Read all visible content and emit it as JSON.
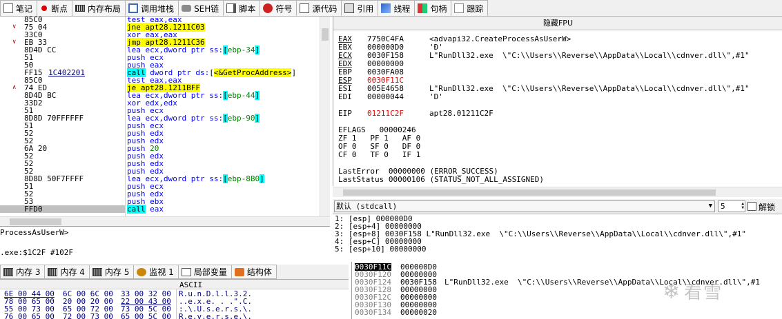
{
  "toolbar": {
    "tabs": [
      {
        "label": "笔记",
        "icon": "notes-icon"
      },
      {
        "label": "断点",
        "icon": "breakpoint-icon"
      },
      {
        "label": "内存布局",
        "icon": "memory-map-icon"
      },
      {
        "label": "调用堆栈",
        "icon": "call-stack-icon"
      },
      {
        "label": "SEH链",
        "icon": "seh-chain-icon"
      },
      {
        "label": "脚本",
        "icon": "script-icon"
      },
      {
        "label": "符号",
        "icon": "symbols-icon"
      },
      {
        "label": "源代码",
        "icon": "source-code-icon"
      },
      {
        "label": "引用",
        "icon": "references-icon"
      },
      {
        "label": "线程",
        "icon": "threads-icon"
      },
      {
        "label": "句柄",
        "icon": "handles-icon"
      },
      {
        "label": "跟踪",
        "icon": "trace-icon"
      }
    ]
  },
  "disasm": {
    "lines": [
      {
        "bytes": "85C0",
        "mark": "",
        "parts": [
          {
            "t": "test eax,eax",
            "c": "blue"
          }
        ]
      },
      {
        "bytes": "75 04",
        "mark": "v",
        "parts": [
          {
            "t": "jne apt28.1211C03",
            "c": "hl-y"
          }
        ]
      },
      {
        "bytes": "33C0",
        "mark": "",
        "parts": [
          {
            "t": "xor eax,eax",
            "c": "blue"
          }
        ]
      },
      {
        "bytes": "EB 33",
        "mark": "v",
        "parts": [
          {
            "t": "jmp apt28.1211C36",
            "c": "hl-y"
          }
        ]
      },
      {
        "bytes": "8D4D CC",
        "mark": "",
        "parts": [
          {
            "t": "lea ecx,dword ptr ss:",
            "c": "blue"
          },
          {
            "t": "[",
            "c": "hl-c"
          },
          {
            "t": "ebp-34",
            "c": "green"
          },
          {
            "t": "]",
            "c": "hl-c"
          }
        ]
      },
      {
        "bytes": "51",
        "mark": "",
        "parts": [
          {
            "t": "push ecx",
            "c": "blue"
          }
        ]
      },
      {
        "bytes": "50",
        "mark": "",
        "parts": [
          {
            "t": "push eax",
            "c": "blue"
          }
        ]
      },
      {
        "bytes": "FF15 ",
        "bytes2": "1C402201",
        "mark": "",
        "parts": [
          {
            "t": "call",
            "c": "hl-c"
          },
          {
            "t": " dword ptr ds:",
            "c": "blue"
          },
          {
            "t": "[",
            "c": "bracket"
          },
          {
            "t": "<&GetProcAddress>",
            "c": "hl-y"
          },
          {
            "t": "]",
            "c": "bracket"
          }
        ]
      },
      {
        "bytes": "85C0",
        "mark": "",
        "parts": [
          {
            "t": "test eax,eax",
            "c": "blue"
          }
        ]
      },
      {
        "bytes": "74 ED",
        "mark": "^",
        "parts": [
          {
            "t": "je apt28.1211BFF",
            "c": "hl-y"
          }
        ]
      },
      {
        "bytes": "8D4D BC",
        "mark": "",
        "parts": [
          {
            "t": "lea ecx,dword ptr ss:",
            "c": "blue"
          },
          {
            "t": "[",
            "c": "hl-c"
          },
          {
            "t": "ebp-44",
            "c": "green"
          },
          {
            "t": "]",
            "c": "hl-c"
          }
        ]
      },
      {
        "bytes": "33D2",
        "mark": "",
        "parts": [
          {
            "t": "xor edx,edx",
            "c": "blue"
          }
        ]
      },
      {
        "bytes": "51",
        "mark": "",
        "parts": [
          {
            "t": "push ecx",
            "c": "blue"
          }
        ]
      },
      {
        "bytes": "8D8D 70FFFFFF",
        "mark": "",
        "parts": [
          {
            "t": "lea ecx,dword ptr ss:",
            "c": "blue"
          },
          {
            "t": "[",
            "c": "hl-c"
          },
          {
            "t": "ebp-90",
            "c": "green"
          },
          {
            "t": "]",
            "c": "hl-c"
          }
        ]
      },
      {
        "bytes": "51",
        "mark": "",
        "parts": [
          {
            "t": "push ecx",
            "c": "blue"
          }
        ]
      },
      {
        "bytes": "52",
        "mark": "",
        "parts": [
          {
            "t": "push edx",
            "c": "blue"
          }
        ]
      },
      {
        "bytes": "52",
        "mark": "",
        "parts": [
          {
            "t": "push edx",
            "c": "blue"
          }
        ]
      },
      {
        "bytes": "6A 20",
        "mark": "",
        "parts": [
          {
            "t": "push ",
            "c": "blue"
          },
          {
            "t": "20",
            "c": "green"
          }
        ]
      },
      {
        "bytes": "52",
        "mark": "",
        "parts": [
          {
            "t": "push edx",
            "c": "blue"
          }
        ]
      },
      {
        "bytes": "52",
        "mark": "",
        "parts": [
          {
            "t": "push edx",
            "c": "blue"
          }
        ]
      },
      {
        "bytes": "52",
        "mark": "",
        "parts": [
          {
            "t": "push edx",
            "c": "blue"
          }
        ]
      },
      {
        "bytes": "8D8D 50F7FFFF",
        "mark": "",
        "parts": [
          {
            "t": "lea ecx,dword ptr ss:",
            "c": "blue"
          },
          {
            "t": "[",
            "c": "hl-c"
          },
          {
            "t": "ebp-8B0",
            "c": "green"
          },
          {
            "t": "]",
            "c": "hl-c"
          }
        ]
      },
      {
        "bytes": "51",
        "mark": "",
        "parts": [
          {
            "t": "push ecx",
            "c": "blue"
          }
        ]
      },
      {
        "bytes": "52",
        "mark": "",
        "parts": [
          {
            "t": "push edx",
            "c": "blue"
          }
        ]
      },
      {
        "bytes": "53",
        "mark": "",
        "parts": [
          {
            "t": "push ebx",
            "c": "blue"
          }
        ]
      },
      {
        "bytes": "FFD0",
        "mark": "",
        "sel": true,
        "parts": [
          {
            "t": "call",
            "c": "hl-c"
          },
          {
            "t": " eax",
            "c": "blue"
          }
        ]
      }
    ]
  },
  "info": {
    "line1": "ProcessAsUserW>",
    "line2": ".exe:$1C2F #102F"
  },
  "registers": {
    "fpu_button": "隐藏FPU",
    "rows": [
      {
        "name": "EAX",
        "value": "7750C4FA",
        "comment": "<advapi32.CreateProcessAsUserW>",
        "ul": true,
        "red": false
      },
      {
        "name": "EBX",
        "value": "000000D0",
        "comment": "'Ð'",
        "ul": false,
        "red": false
      },
      {
        "name": "ECX",
        "value": "0030F158",
        "comment": "L\"RunDll32.exe  \\\"C:\\\\Users\\\\Reverse\\\\AppData\\\\Local\\\\cdnver.dll\\\",#1\"",
        "ul": true,
        "red": false
      },
      {
        "name": "EDX",
        "value": "00000000",
        "comment": "",
        "ul": true,
        "red": false
      },
      {
        "name": "EBP",
        "value": "0030FA08",
        "comment": "",
        "ul": false,
        "red": false
      },
      {
        "name": "ESP",
        "value": "0030F11C",
        "comment": "",
        "ul": true,
        "red": true
      },
      {
        "name": "ESI",
        "value": "005E4658",
        "comment": "L\"RunDll32.exe  \\\"C:\\\\Users\\\\Reverse\\\\AppData\\\\Local\\\\cdnver.dll\\\",#1\"",
        "ul": false,
        "red": false
      },
      {
        "name": "EDI",
        "value": "00000044",
        "comment": "'D'",
        "ul": false,
        "red": false
      }
    ],
    "eip": {
      "name": "EIP",
      "value": "01211C2F",
      "comment": "apt28.01211C2F"
    },
    "eflags": "EFLAGS   00000246",
    "flags1": "ZF 1   PF 1   AF 0",
    "flags2": "OF 0   SF 0   DF 0",
    "flags3": "CF 0   TF 0   IF 1",
    "lasterror": "LastError  00000000 (ERROR_SUCCESS)",
    "laststatus": "LastStatus 00000106 (STATUS_NOT_ALL_ASSIGNED)"
  },
  "callconv": {
    "selected": "默认 (stdcall)",
    "arg_count": "5",
    "lock_label": "解锁"
  },
  "args": [
    "1: [esp] 000000D0",
    "2: [esp+4] 00000000",
    "3: [esp+8] 0030F158 L\"RunDll32.exe  \\\"C:\\\\Users\\\\Reverse\\\\AppData\\\\Local\\\\cdnver.dll\\\",#1\"",
    "4: [esp+C] 00000000",
    "5: [esp+10] 00000000"
  ],
  "bottom_tabs": [
    {
      "label": "内存 3",
      "icon": "memory-icon"
    },
    {
      "label": "内存 4",
      "icon": "memory-icon"
    },
    {
      "label": "内存 5",
      "icon": "memory-icon"
    },
    {
      "label": "监视 1",
      "icon": "watch-icon"
    },
    {
      "label": "局部变量",
      "icon": "locals-icon"
    },
    {
      "label": "结构体",
      "icon": "struct-icon"
    }
  ],
  "dump": {
    "ascii_header": "ASCII",
    "rows": [
      {
        "h1": "6E 00 44 00",
        "h2": "6C 00 6C 00",
        "h3": "33 00 32 00",
        "a": "R.u.n.D.l.l.3.2."
      },
      {
        "h1": "78 00 65 00",
        "h2": "20 00 20 00",
        "h3": "22 00 43 00",
        "a": "..e.x.e. . .\".C."
      },
      {
        "h1": "55 00 73 00",
        "h2": "65 00 72 00",
        "h3": "73 00 5C 00",
        "a": ":.\\.U.s.e.r.s.\\."
      },
      {
        "h1": "76 00 65 00",
        "h2": "72 00 73 00",
        "h3": "65 00 5C 00",
        "a": "R.e.v.e.r.s.e.\\."
      }
    ]
  },
  "stack": {
    "rows": [
      {
        "addr": "0030F11C",
        "val": "000000D0",
        "comment": "",
        "sel": true
      },
      {
        "addr": "0030F120",
        "val": "00000000",
        "comment": ""
      },
      {
        "addr": "0030F124",
        "val": "0030F158",
        "comment": "L\"RunDll32.exe  \\\"C:\\\\Users\\\\Reverse\\\\AppData\\\\Local\\\\cdnver.dll\\\",#1"
      },
      {
        "addr": "0030F128",
        "val": "00000000",
        "comment": ""
      },
      {
        "addr": "0030F12C",
        "val": "00000000",
        "comment": ""
      },
      {
        "addr": "0030F130",
        "val": "00000000",
        "comment": ""
      },
      {
        "addr": "0030F134",
        "val": "00000020",
        "comment": ""
      }
    ]
  },
  "watermark": "看雪",
  "colors": {
    "highlight_yellow": "#ffff00",
    "highlight_cyan": "#00ffff",
    "instruction_blue": "#0000ff",
    "register_red": "#e00000"
  }
}
